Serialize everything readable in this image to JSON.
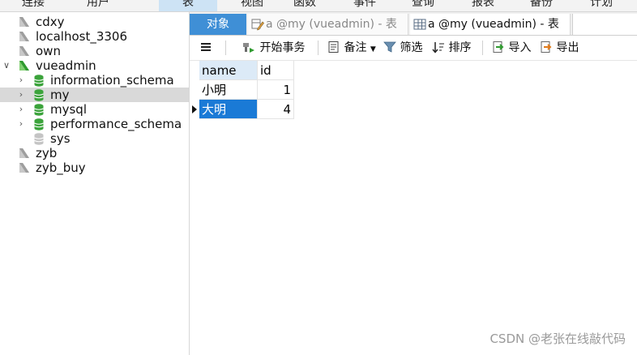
{
  "menu": {
    "items": [
      "连接",
      "用户",
      "表",
      "视图",
      "函数",
      "事件",
      "查询",
      "报表",
      "备份",
      "计划"
    ]
  },
  "sidebar": {
    "items": [
      {
        "label": "cdxy",
        "type": "connection"
      },
      {
        "label": "localhost_3306",
        "type": "connection"
      },
      {
        "label": "own",
        "type": "connection"
      },
      {
        "label": "vueadmin",
        "type": "connection-open"
      },
      {
        "label": "information_schema",
        "type": "database"
      },
      {
        "label": "my",
        "type": "database",
        "selected": true
      },
      {
        "label": "mysql",
        "type": "database"
      },
      {
        "label": "performance_schema",
        "type": "database"
      },
      {
        "label": "sys",
        "type": "database-closed"
      },
      {
        "label": "zyb",
        "type": "connection"
      },
      {
        "label": "zyb_buy",
        "type": "connection"
      }
    ]
  },
  "tabs": {
    "objects": "对象",
    "design_tab": "a @my (vueadmin) - 表",
    "data_tab": "a @my (vueadmin) - 表"
  },
  "toolbar": {
    "begin_transaction": "开始事务",
    "note": "备注",
    "filter": "筛选",
    "sort": "排序",
    "import": "导入",
    "export": "导出"
  },
  "grid": {
    "columns": [
      "name",
      "id"
    ],
    "rows": [
      {
        "name": "小明",
        "id": "1"
      },
      {
        "name": "大明",
        "id": "4"
      }
    ]
  },
  "watermark": "CSDN @老张在线敲代码",
  "colors": {
    "accent": "#3f8fd6",
    "selected_cell": "#1a7ad6",
    "db_icon": "#3ba33b",
    "connection_open": "#3ba33b"
  }
}
